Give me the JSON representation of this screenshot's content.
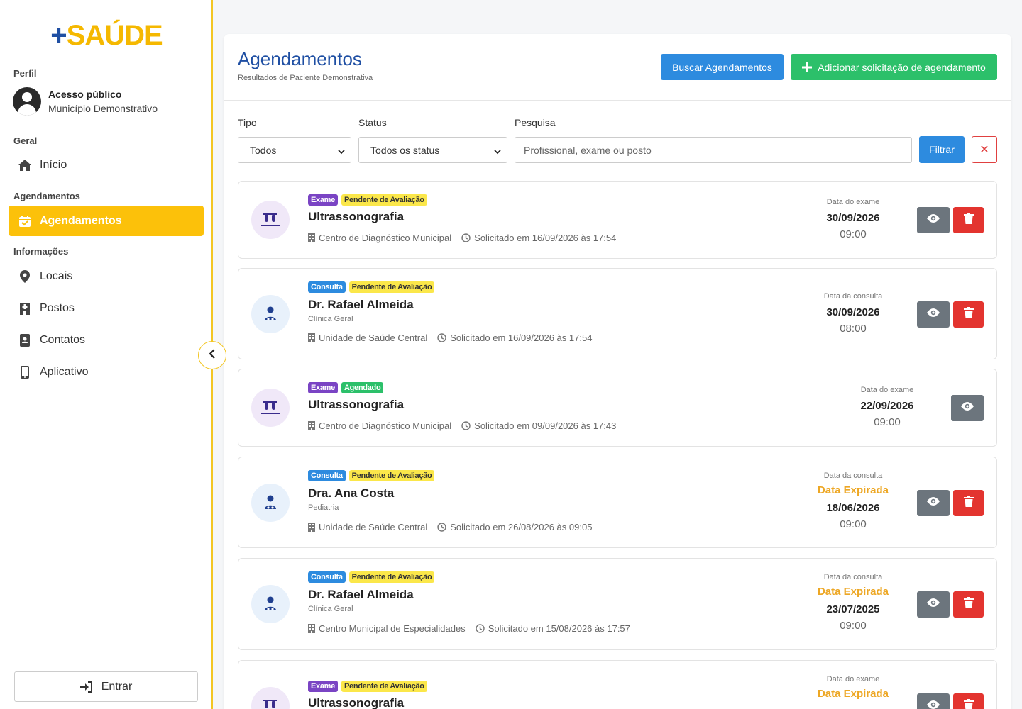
{
  "logo": {
    "plus": "+",
    "word": "SAÚDE"
  },
  "sidebar": {
    "profile_section": "Perfil",
    "profile_name": "Acesso público",
    "profile_sub": "Município Demonstrativo",
    "sections": {
      "geral": "Geral",
      "agendamentos": "Agendamentos",
      "informacoes": "Informações"
    },
    "items": {
      "inicio": "Início",
      "agendamentos": "Agendamentos",
      "locais": "Locais",
      "postos": "Postos",
      "contatos": "Contatos",
      "aplicativo": "Aplicativo"
    },
    "entrar": "Entrar"
  },
  "header": {
    "title": "Agendamentos",
    "subtitle": "Resultados de Paciente Demonstrativa",
    "search_button": "Buscar Agendamentos",
    "add_button": "Adicionar solicitação de agendamento"
  },
  "filters": {
    "tipo_label": "Tipo",
    "tipo_value": "Todos",
    "status_label": "Status",
    "status_value": "Todos os status",
    "search_label": "Pesquisa",
    "search_placeholder": "Profissional, exame ou posto",
    "filter_button": "Filtrar",
    "clear_button": "✕"
  },
  "appointments": [
    {
      "type": "Exame",
      "status": "Pendente de Avaliação",
      "title": "Ultrassonografia",
      "specialty": "",
      "location": "Centro de Diagnóstico Municipal",
      "requested": "Solicitado em 16/09/2026 às 17:54",
      "date_label": "Data do exame",
      "expired": "",
      "date": "30/09/2026",
      "time": "09:00"
    },
    {
      "type": "Consulta",
      "status": "Pendente de Avaliação",
      "title": "Dr. Rafael Almeida",
      "specialty": "Clínica Geral",
      "location": "Unidade de Saúde Central",
      "requested": "Solicitado em 16/09/2026 às 17:54",
      "date_label": "Data da consulta",
      "expired": "",
      "date": "30/09/2026",
      "time": "08:00"
    },
    {
      "type": "Exame",
      "status": "Agendado",
      "title": "Ultrassonografia",
      "specialty": "",
      "location": "Centro de Diagnóstico Municipal",
      "requested": "Solicitado em 09/09/2026 às 17:43",
      "date_label": "Data do exame",
      "expired": "",
      "date": "22/09/2026",
      "time": "09:00"
    },
    {
      "type": "Consulta",
      "status": "Pendente de Avaliação",
      "title": "Dra. Ana Costa",
      "specialty": "Pediatria",
      "location": "Unidade de Saúde Central",
      "requested": "Solicitado em 26/08/2026 às 09:05",
      "date_label": "Data da consulta",
      "expired": "Data Expirada",
      "date": "18/06/2026",
      "time": "09:00"
    },
    {
      "type": "Consulta",
      "status": "Pendente de Avaliação",
      "title": "Dr. Rafael Almeida",
      "specialty": "Clínica Geral",
      "location": "Centro Municipal de Especialidades",
      "requested": "Solicitado em 15/08/2026 às 17:57",
      "date_label": "Data da consulta",
      "expired": "Data Expirada",
      "date": "23/07/2025",
      "time": "09:00"
    },
    {
      "type": "Exame",
      "status": "Pendente de Avaliação",
      "title": "Ultrassonografia",
      "specialty": "",
      "location": "",
      "requested": "",
      "date_label": "Data do exame",
      "expired": "Data Expirada",
      "date": "",
      "time": ""
    }
  ],
  "colors": {
    "brand_blue": "#1f4fa3",
    "brand_yellow": "#fcc10a",
    "expired": "#eda724"
  }
}
